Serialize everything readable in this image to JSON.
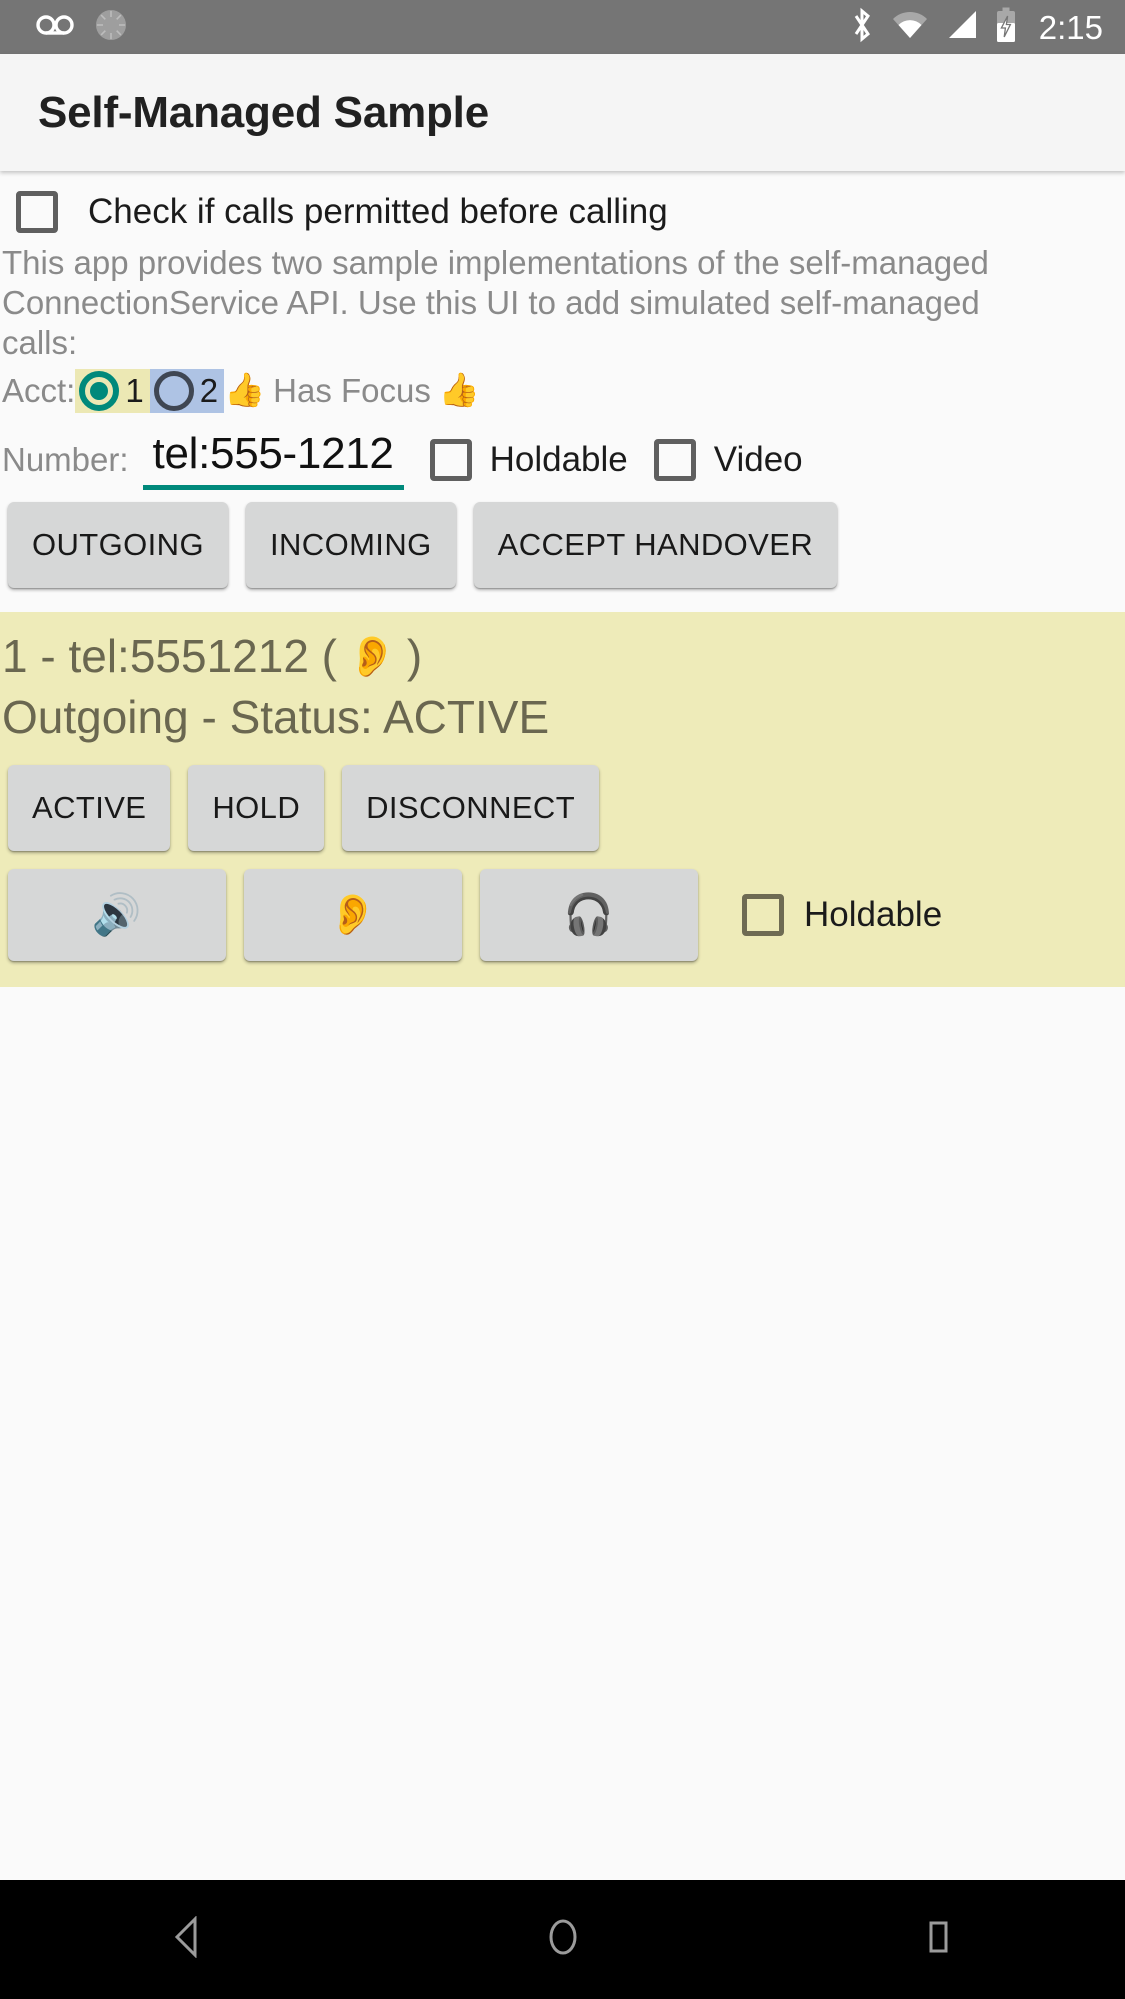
{
  "status_bar": {
    "icons_left": [
      "voicemail-icon",
      "sync-spinner-icon"
    ],
    "icons_right": [
      "bluetooth-icon",
      "wifi-icon",
      "cellular-signal-icon",
      "battery-charging-icon"
    ],
    "time": "2:15",
    "background": "#757575"
  },
  "app_bar": {
    "title": "Self-Managed Sample",
    "background": "#f5f5f5"
  },
  "permission": {
    "checkbox_label": "Check if calls permitted before calling",
    "checked": false
  },
  "description": "This app provides two sample implementations of the self-managed ConnectionService API.  Use this UI to add simulated self-managed calls:",
  "account": {
    "label": "Acct:",
    "options": [
      {
        "value": "1",
        "selected": true,
        "chip_color": "#ece8b4",
        "radio_color": "#00897b"
      },
      {
        "value": "2",
        "selected": false,
        "chip_color": "#aec3e4",
        "radio_color": "#3f4652"
      }
    ],
    "focus_emoji_left": "👍",
    "focus_text": "Has Focus",
    "focus_emoji_right": "👍"
  },
  "number": {
    "label": "Number:",
    "value": "tel:555-1212",
    "placeholder": "tel:555-1212",
    "underline_color": "#00897b",
    "holdable": {
      "label": "Holdable",
      "checked": false
    },
    "video": {
      "label": "Video",
      "checked": false
    }
  },
  "actions": {
    "outgoing": "OUTGOING",
    "incoming": "INCOMING",
    "accept_handover": "ACCEPT HANDOVER"
  },
  "call": {
    "background": "#eeebb9",
    "title_prefix": "1 - tel:5551212 (",
    "title_route_icon": "👂",
    "title_suffix": ")",
    "status_line": "Outgoing - Status: ACTIVE",
    "controls": {
      "active": "ACTIVE",
      "hold": "HOLD",
      "disconnect": "DISCONNECT"
    },
    "audio_routes": [
      {
        "icon": "🔊",
        "name": "speaker-route"
      },
      {
        "icon": "👂",
        "name": "earpiece-route"
      },
      {
        "icon": "🎧",
        "name": "headset-route"
      }
    ],
    "holdable": {
      "label": "Holdable",
      "checked": false
    }
  },
  "nav_bar": {
    "back": "back-icon",
    "home": "home-icon",
    "recents": "recents-icon",
    "background": "#000000"
  }
}
